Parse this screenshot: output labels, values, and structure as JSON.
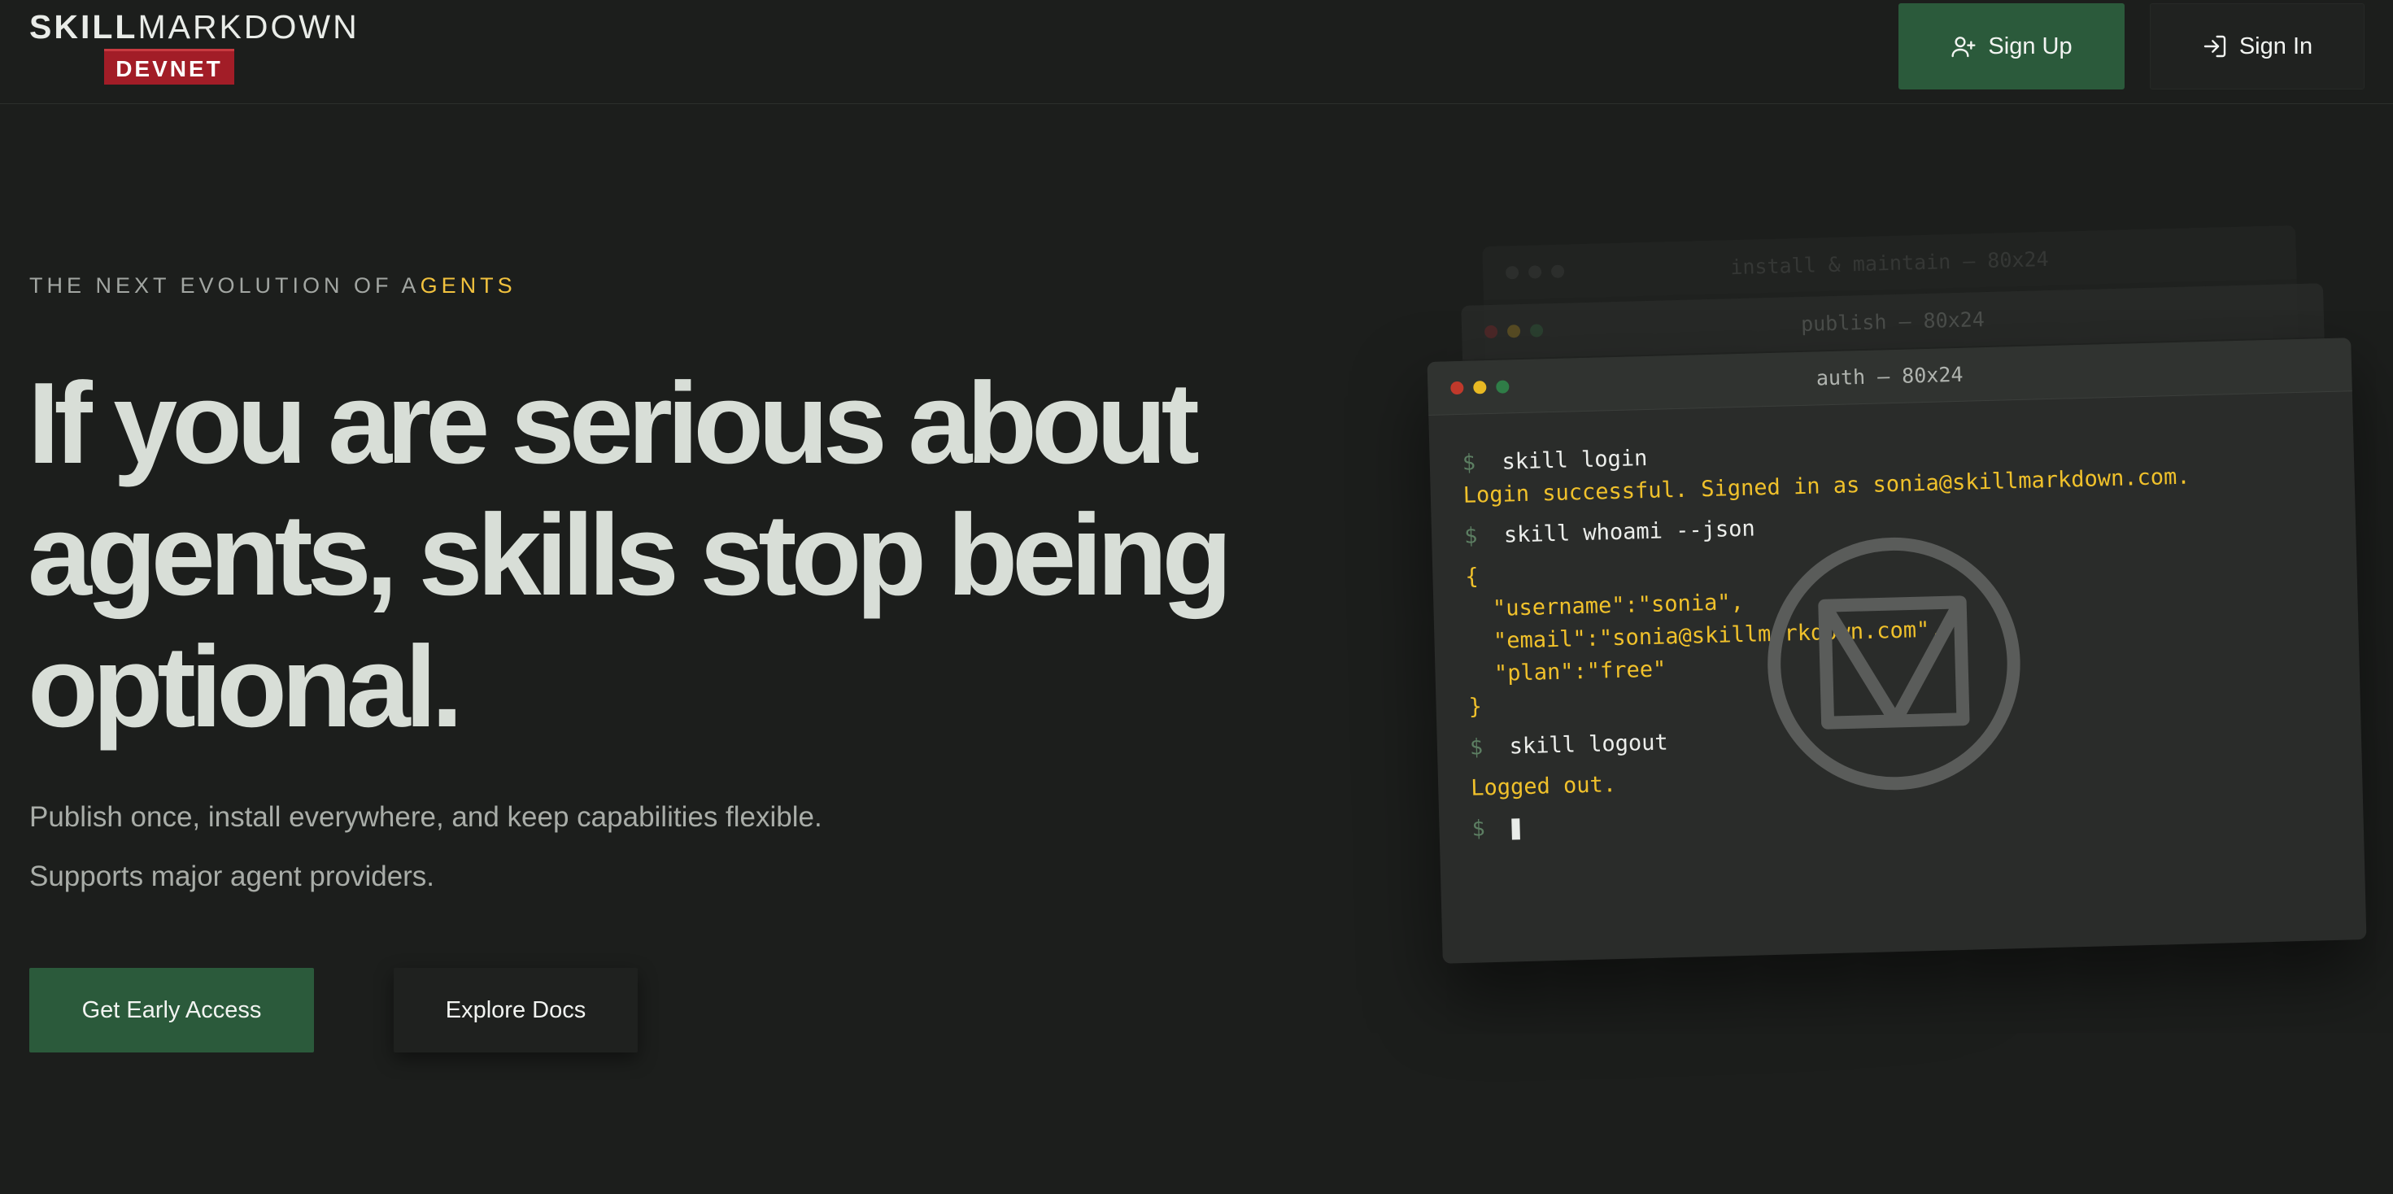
{
  "header": {
    "logo_bold": "SKILL",
    "logo_light": "MARKDOWN",
    "logo_badge": "DEVNET",
    "signup_label": "Sign Up",
    "signin_label": "Sign In"
  },
  "hero": {
    "eyebrow_prefix": "THE NEXT EVOLUTION OF A",
    "eyebrow_highlight": "GENTS",
    "headline_lines": [
      "If you are serious about",
      "agents, skills stop being",
      "optional."
    ],
    "subtitle_1": "Publish once, install everywhere, and keep capabilities flexible.",
    "subtitle_2": "Supports major agent providers.",
    "cta_primary": "Get Early Access",
    "cta_secondary": "Explore Docs"
  },
  "terminals": {
    "back_title": "install & maintain — 80x24",
    "mid_title": "publish — 80x24",
    "front_title": "auth — 80x24",
    "prompt": "$",
    "lines": [
      {
        "kind": "cmd",
        "text": "skill login"
      },
      {
        "kind": "out",
        "text": "Login successful. Signed in as sonia@skillmarkdown.com."
      },
      {
        "kind": "cmd",
        "text": "skill whoami --json"
      },
      {
        "kind": "out",
        "text": "{"
      },
      {
        "kind": "out",
        "text": "  \"username\":\"sonia\","
      },
      {
        "kind": "out",
        "text": "  \"email\":\"sonia@skillmarkdown.com\","
      },
      {
        "kind": "out",
        "text": "  \"plan\":\"free\""
      },
      {
        "kind": "out",
        "text": "}"
      },
      {
        "kind": "cmd",
        "text": "skill logout"
      },
      {
        "kind": "out",
        "text": "Logged out."
      }
    ],
    "watermark_icon": "skillmarkdown-m-logo-icon"
  },
  "colors": {
    "background": "#1c1e1c",
    "accent_green": "#2b5a3b",
    "badge_red": "#a21d27",
    "output_yellow": "#f0c12b"
  }
}
